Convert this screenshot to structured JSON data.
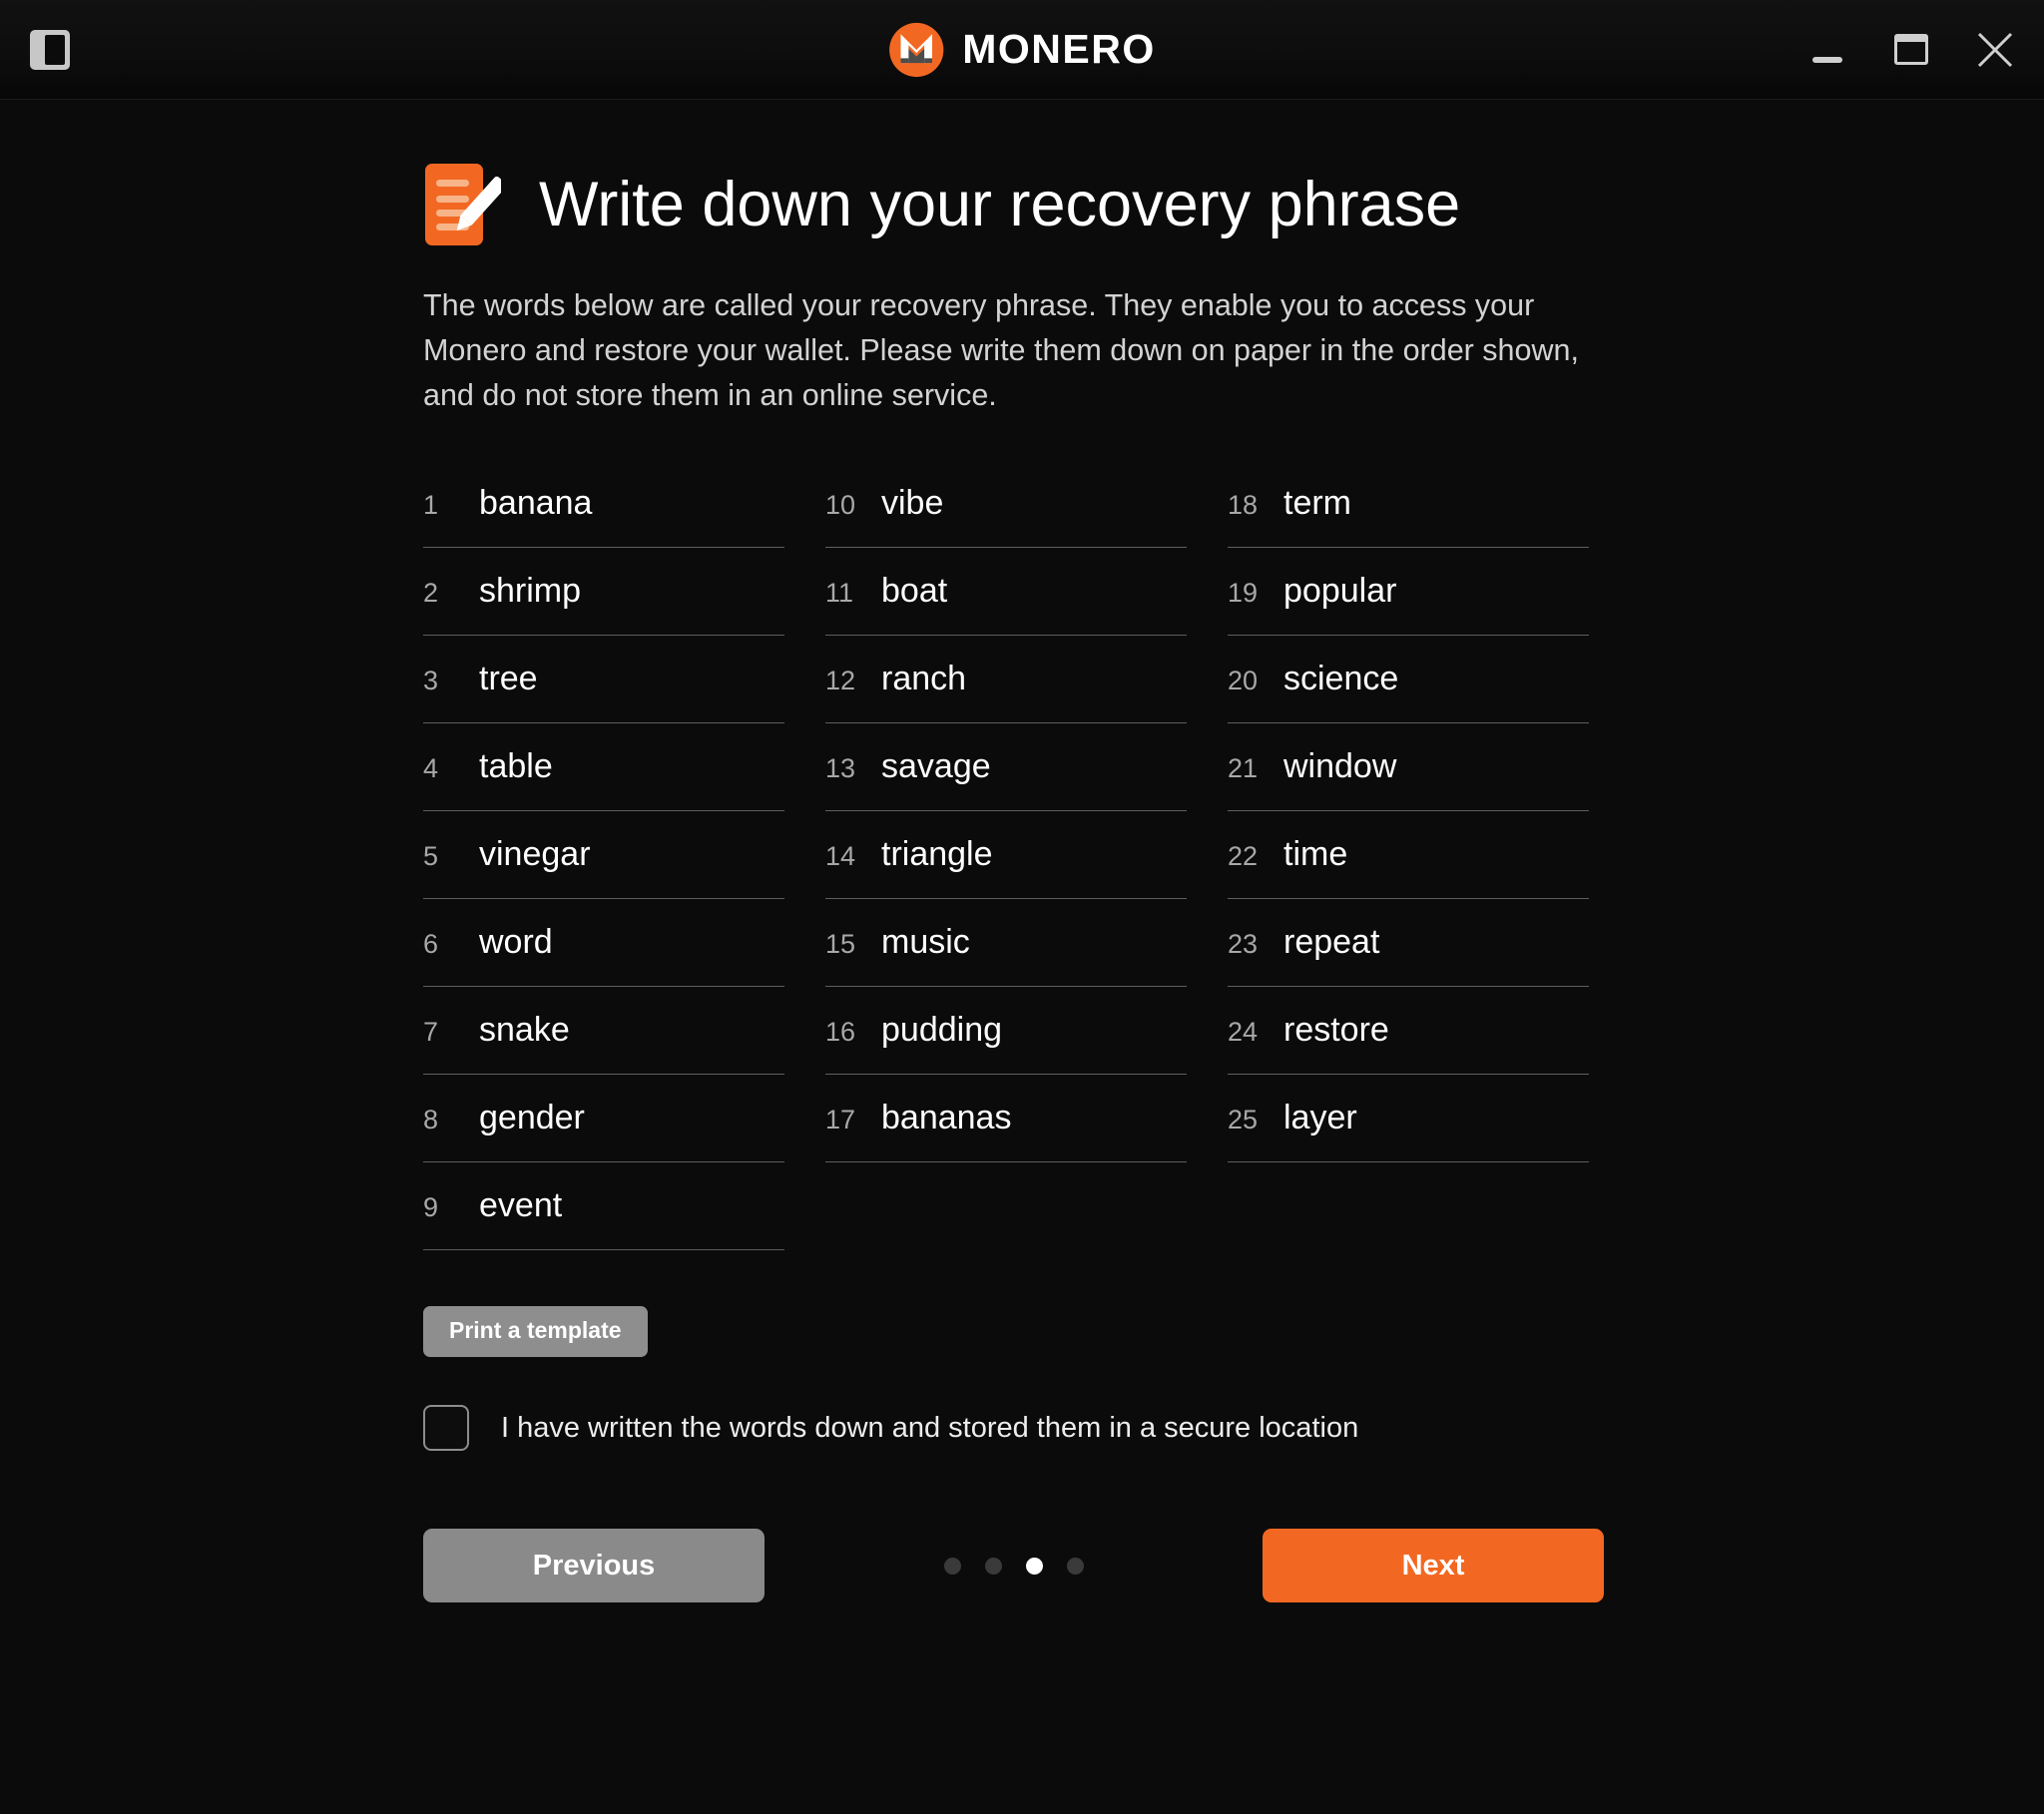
{
  "window": {
    "brand_name": "MONERO",
    "sidebar_toggle_icon": "sidebar-panel-icon",
    "minimize_icon": "minimize-icon",
    "maximize_icon": "maximize-icon",
    "close_icon": "close-icon"
  },
  "page": {
    "icon": "document-pencil-icon",
    "title": "Write down your recovery phrase",
    "description": "The words below are called your recovery phrase. They enable you to access your Monero and restore your wallet. Please write them down on paper in the order shown, and do not store them in an online service."
  },
  "recovery_phrase": {
    "columns": [
      [
        {
          "index": "1",
          "word": "banana"
        },
        {
          "index": "2",
          "word": "shrimp"
        },
        {
          "index": "3",
          "word": "tree"
        },
        {
          "index": "4",
          "word": "table"
        },
        {
          "index": "5",
          "word": "vinegar"
        },
        {
          "index": "6",
          "word": "word"
        },
        {
          "index": "7",
          "word": "snake"
        },
        {
          "index": "8",
          "word": "gender"
        },
        {
          "index": "9",
          "word": "event"
        }
      ],
      [
        {
          "index": "10",
          "word": "vibe"
        },
        {
          "index": "11",
          "word": "boat"
        },
        {
          "index": "12",
          "word": "ranch"
        },
        {
          "index": "13",
          "word": "savage"
        },
        {
          "index": "14",
          "word": "triangle"
        },
        {
          "index": "15",
          "word": "music"
        },
        {
          "index": "16",
          "word": "pudding"
        },
        {
          "index": "17",
          "word": "bananas"
        }
      ],
      [
        {
          "index": "18",
          "word": "term"
        },
        {
          "index": "19",
          "word": "popular"
        },
        {
          "index": "20",
          "word": "science"
        },
        {
          "index": "21",
          "word": "window"
        },
        {
          "index": "22",
          "word": "time"
        },
        {
          "index": "23",
          "word": "repeat"
        },
        {
          "index": "24",
          "word": "restore"
        },
        {
          "index": "25",
          "word": "layer"
        }
      ]
    ]
  },
  "actions": {
    "print_template_label": "Print a template",
    "confirm_checkbox_label": "I have written the words down and stored them in a secure location",
    "confirm_checkbox_checked": false,
    "previous_label": "Previous",
    "next_label": "Next"
  },
  "pagination": {
    "total": 4,
    "active_index": 3
  },
  "colors": {
    "accent": "#f26822",
    "button_gray": "#8a8a8a",
    "background": "#0b0b0b",
    "word_rule": "#5e5e5e"
  }
}
